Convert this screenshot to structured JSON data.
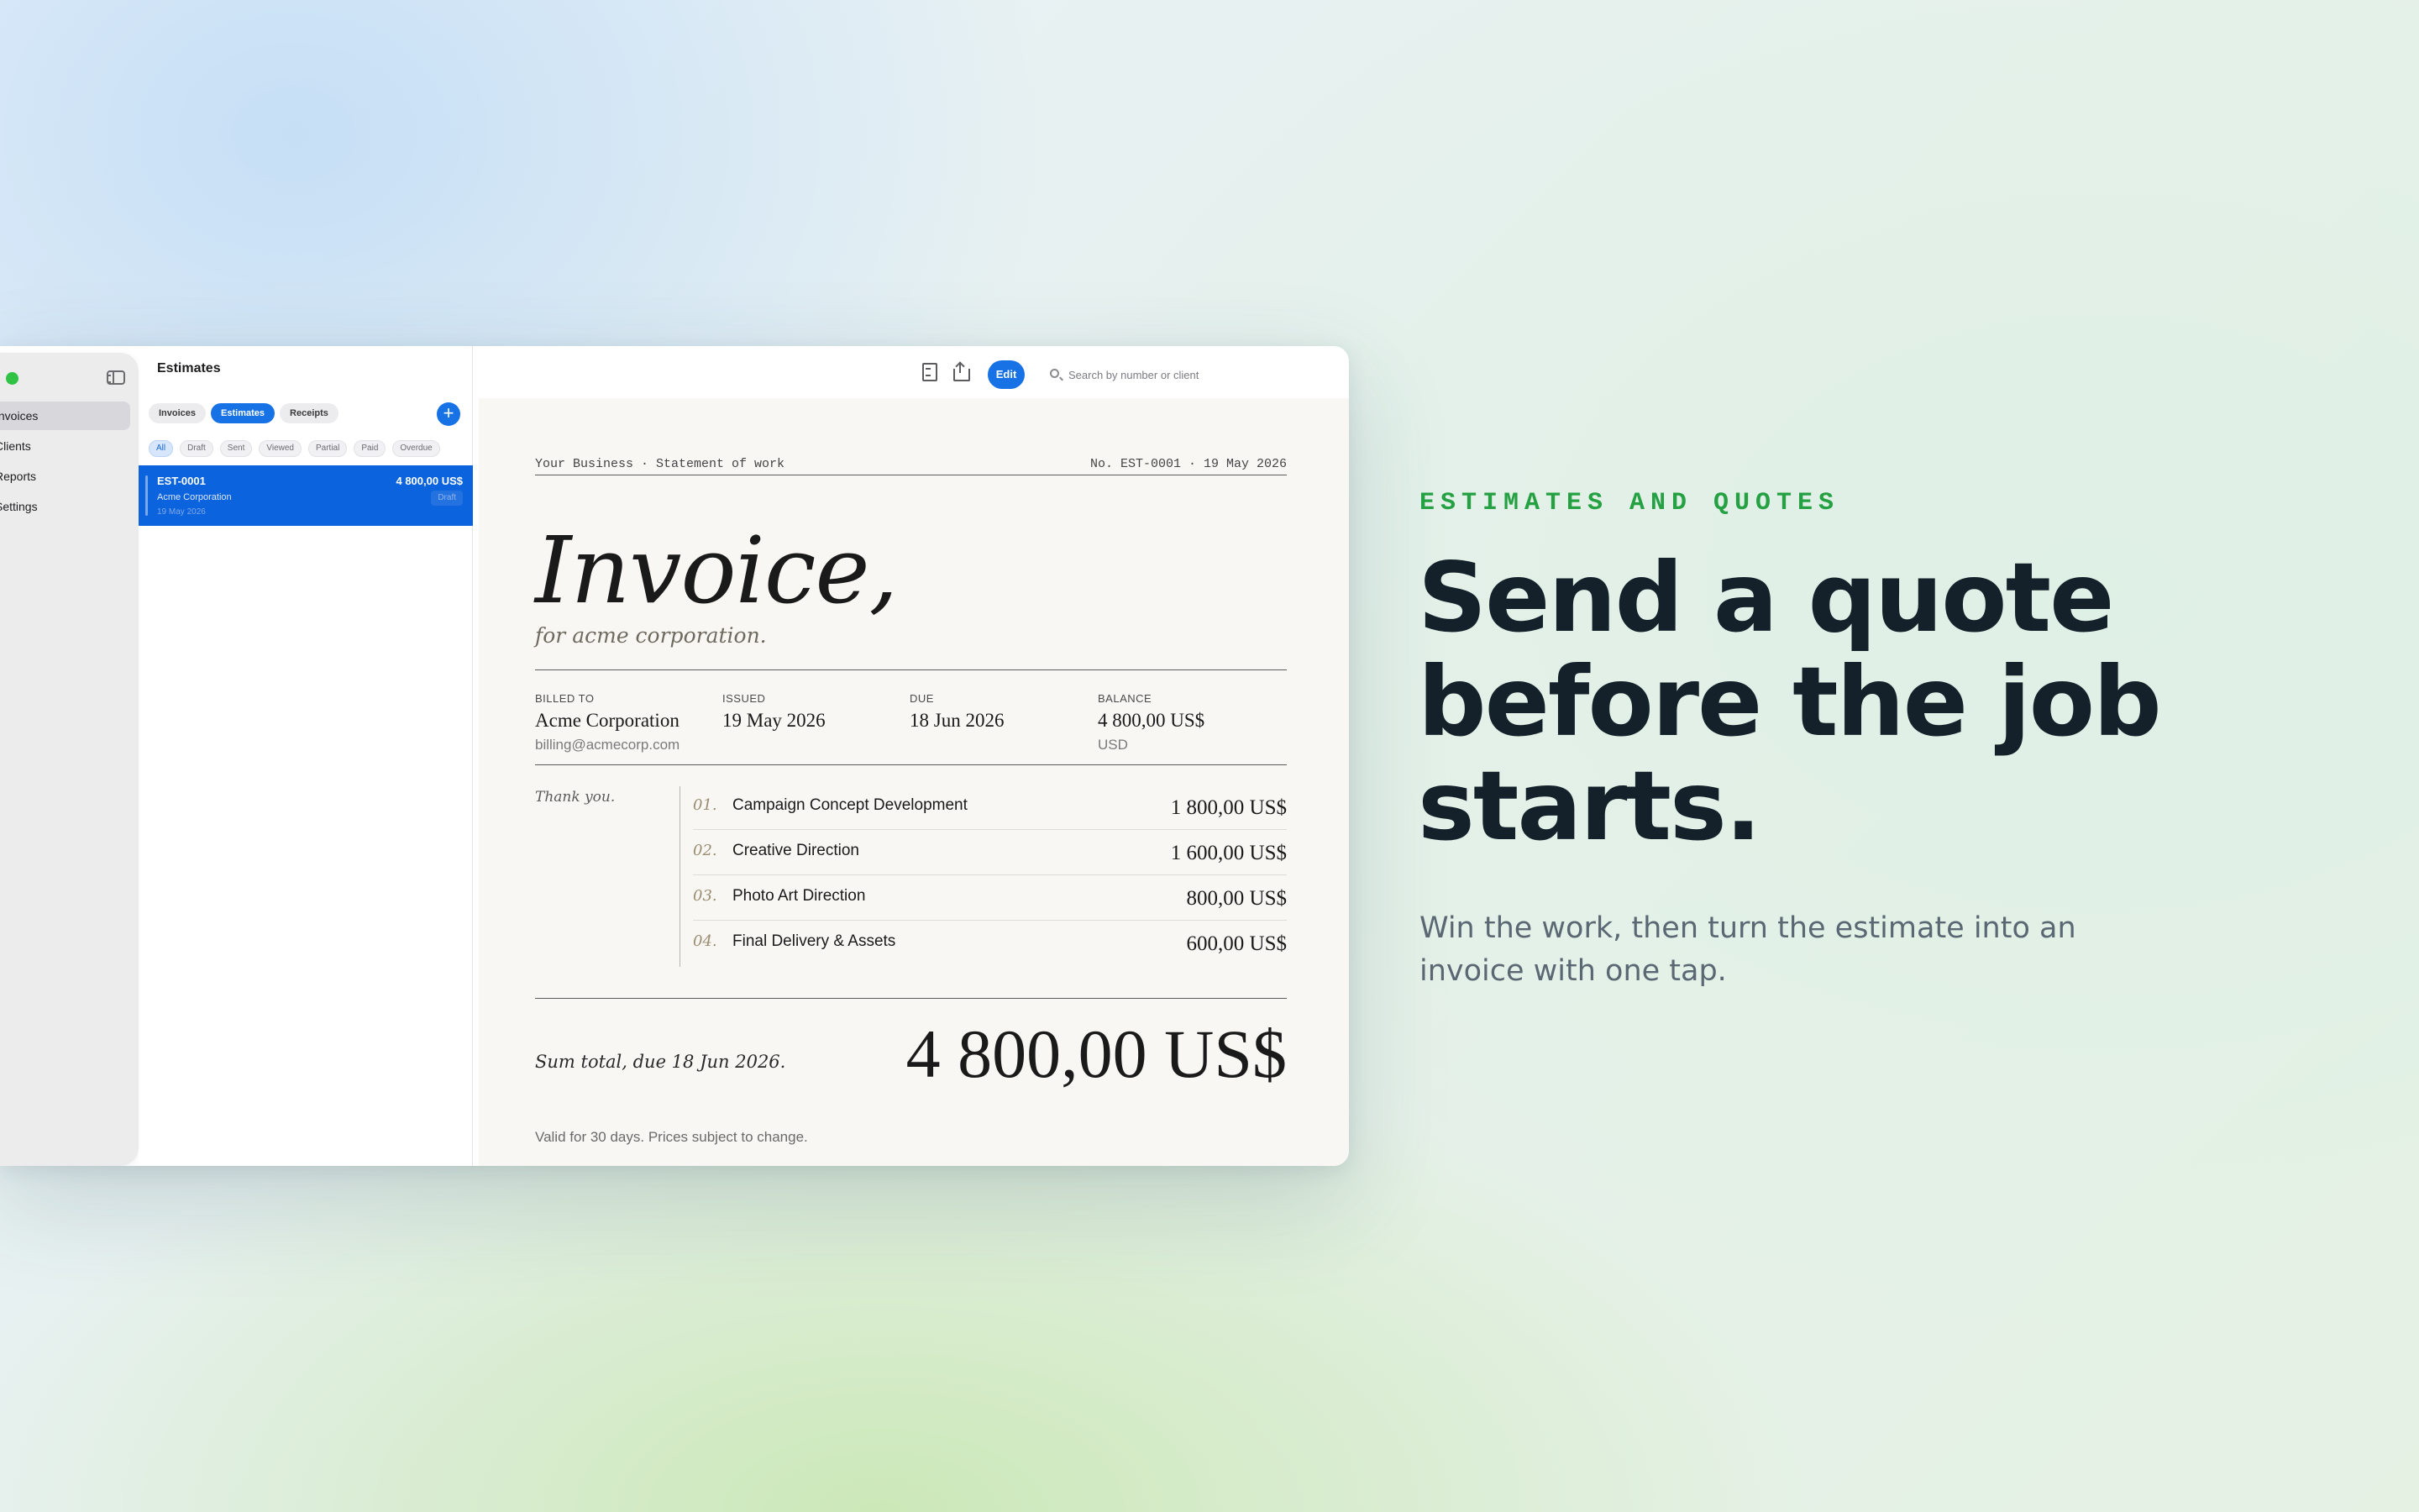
{
  "sidebar": {
    "items": [
      {
        "label": "Invoices",
        "active": true
      },
      {
        "label": "Clients",
        "active": false
      },
      {
        "label": "Reports",
        "active": false
      },
      {
        "label": "Settings",
        "active": false
      }
    ]
  },
  "list": {
    "title": "Estimates",
    "tabs": [
      {
        "label": "Invoices",
        "active": false
      },
      {
        "label": "Estimates",
        "active": true
      },
      {
        "label": "Receipts",
        "active": false
      }
    ],
    "add_label": "+",
    "filters": [
      {
        "label": "All",
        "active": true
      },
      {
        "label": "Draft",
        "active": false
      },
      {
        "label": "Sent",
        "active": false
      },
      {
        "label": "Viewed",
        "active": false
      },
      {
        "label": "Partial",
        "active": false
      },
      {
        "label": "Paid",
        "active": false
      },
      {
        "label": "Overdue",
        "active": false
      }
    ],
    "selected_row": {
      "number": "EST-0001",
      "amount": "4 800,00 US$",
      "client": "Acme Corporation",
      "date": "19 May 2026",
      "status": "Draft"
    }
  },
  "toolbar": {
    "pdf_icon": "document-icon",
    "share_icon": "share-icon",
    "edit_label": "Edit",
    "search_placeholder": "Search by number or client"
  },
  "document": {
    "meta_left": "Your Business · Statement of work",
    "meta_right": "No. EST-0001 · 19 May 2026",
    "title": "Invoice,",
    "subtitle": "for acme corporation.",
    "billed_to": {
      "label": "BILLED TO",
      "value": "Acme Corporation",
      "sub": "billing@acmecorp.com"
    },
    "issued": {
      "label": "ISSUED",
      "value": "19 May 2026"
    },
    "due": {
      "label": "DUE",
      "value": "18 Jun 2026"
    },
    "balance": {
      "label": "BALANCE",
      "value": "4 800,00 US$",
      "sub": "USD"
    },
    "thanks": "Thank you.",
    "line_items": [
      {
        "num": "01.",
        "description": "Campaign Concept Development",
        "amount": "1 800,00 US$"
      },
      {
        "num": "02.",
        "description": "Creative Direction",
        "amount": "1 600,00 US$"
      },
      {
        "num": "03.",
        "description": "Photo Art Direction",
        "amount": "800,00 US$"
      },
      {
        "num": "04.",
        "description": "Final Delivery & Assets",
        "amount": "600,00 US$"
      }
    ],
    "sum_label": "Sum total, due 18 Jun 2026.",
    "sum_amount": "4 800,00 US$",
    "validity": "Valid for 30 days. Prices subject to change."
  },
  "marketing": {
    "eyebrow": "ESTIMATES AND QUOTES",
    "headline_lines": [
      "Send a quote",
      "before the job",
      "starts."
    ],
    "subcopy": "Win the work, then turn the estimate into an invoice with one tap."
  },
  "colors": {
    "accent": "#1772e6",
    "eyebrow": "#25a143",
    "headline": "#14212b"
  }
}
